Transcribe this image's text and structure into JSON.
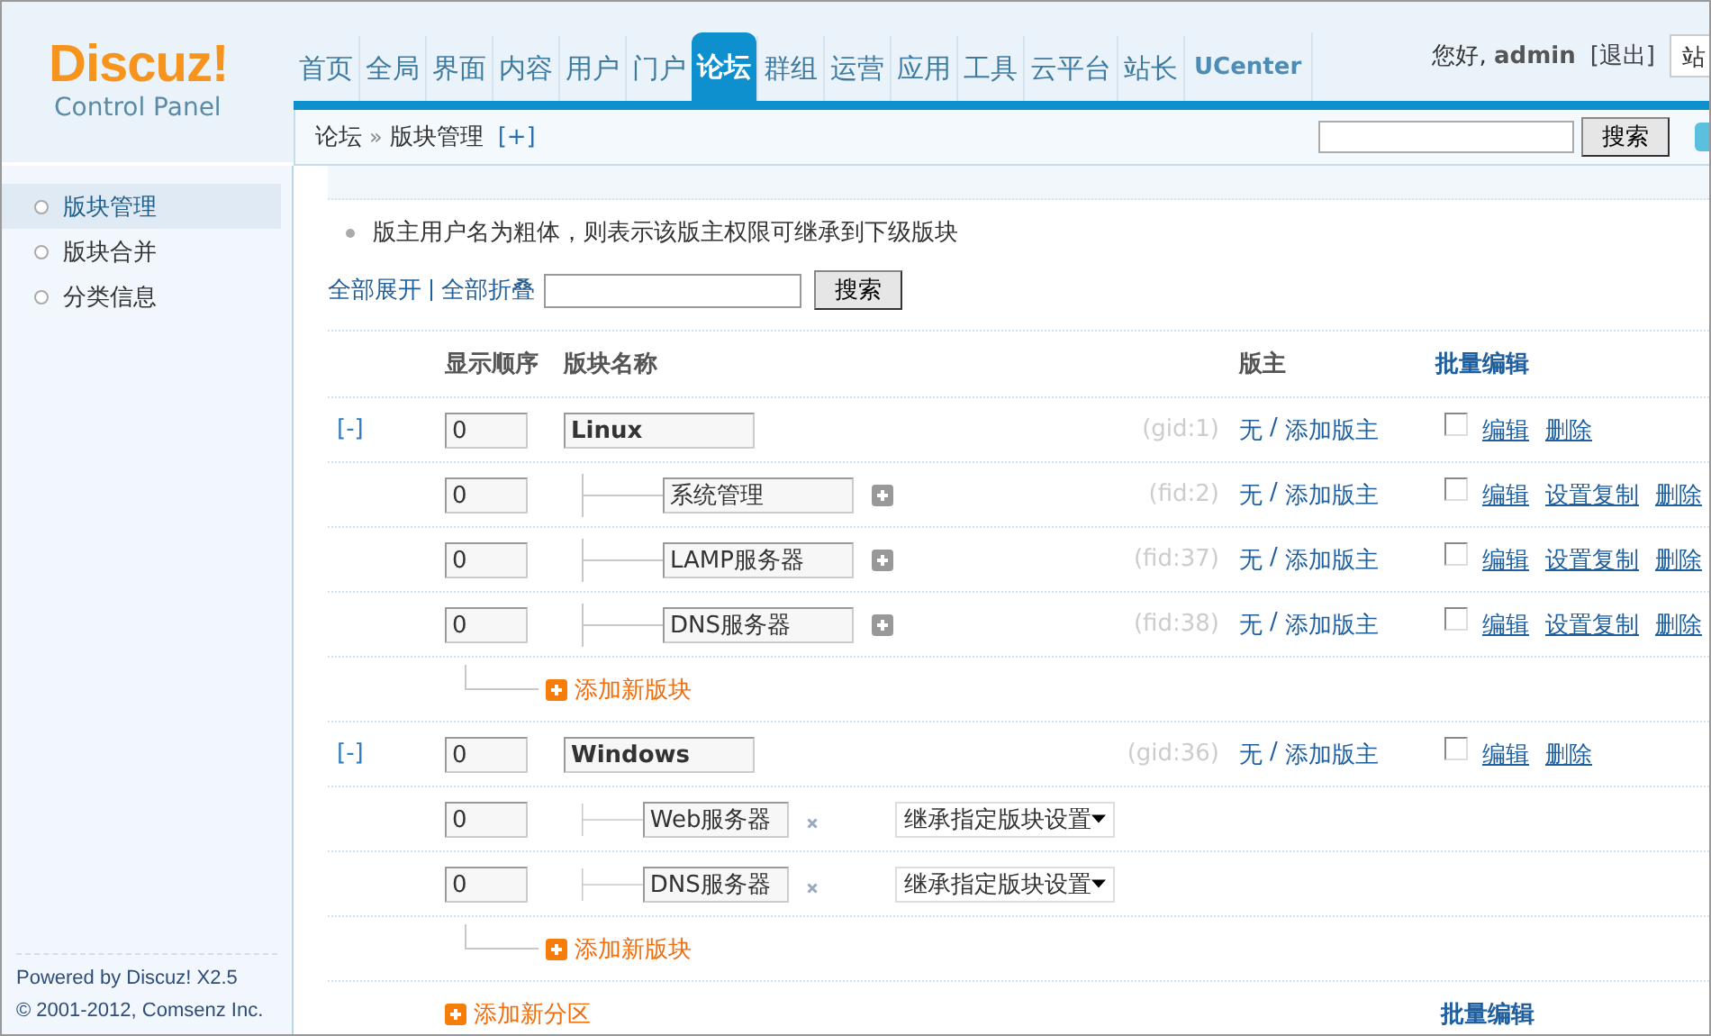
{
  "logo": {
    "name": "Discuz!",
    "subtitle": "Control Panel"
  },
  "nav": [
    {
      "label": "首页",
      "selected": false
    },
    {
      "label": "全局",
      "selected": false
    },
    {
      "label": "界面",
      "selected": false
    },
    {
      "label": "内容",
      "selected": false
    },
    {
      "label": "用户",
      "selected": false
    },
    {
      "label": "门户",
      "selected": false
    },
    {
      "label": "论坛",
      "selected": true
    },
    {
      "label": "群组",
      "selected": false
    },
    {
      "label": "运营",
      "selected": false
    },
    {
      "label": "应用",
      "selected": false
    },
    {
      "label": "工具",
      "selected": false
    },
    {
      "label": "云平台",
      "selected": false
    },
    {
      "label": "站长",
      "selected": false
    },
    {
      "label": "UCenter",
      "selected": false
    }
  ],
  "user": {
    "greeting": "您好,",
    "name": "admin",
    "logout": "[退出]",
    "site_menu": "站"
  },
  "breadcrumb": {
    "items": [
      "论坛",
      "版块管理"
    ],
    "separator": "»",
    "add": "[+]",
    "search_button": "搜索"
  },
  "sidebar": {
    "items": [
      {
        "label": "版块管理",
        "selected": true
      },
      {
        "label": "版块合并",
        "selected": false
      },
      {
        "label": "分类信息",
        "selected": false
      }
    ],
    "footer": [
      "Powered by Discuz! X2.5",
      "© 2001-2012, Comsenz Inc."
    ]
  },
  "tip": "版主用户名为粗体，则表示该版主权限可继承到下级版块",
  "toolbar": {
    "expand_all": "全部展开",
    "collapse_all": "全部折叠",
    "search_button": "搜索"
  },
  "table": {
    "columns": [
      "显示顺序",
      "版块名称",
      "版主",
      "批量编辑"
    ],
    "groups": [
      {
        "toggle": "[-]",
        "order": "0",
        "name": "Linux",
        "id": "(gid:1)",
        "moderator": "无",
        "separator": "/",
        "add_moderator": "添加版主",
        "checked": false,
        "actions": [
          "编辑",
          "删除"
        ],
        "add_forum": "添加新版块",
        "forums": [
          {
            "kind": "expandable",
            "order": "0",
            "name": "系统管理",
            "id": "(fid:2)",
            "moderator": "无",
            "separator": "/",
            "add_moderator": "添加版主",
            "checked": false,
            "actions": [
              "编辑",
              "设置复制",
              "删除"
            ]
          },
          {
            "kind": "expandable",
            "order": "0",
            "name": "LAMP服务器",
            "id": "(fid:37)",
            "moderator": "无",
            "separator": "/",
            "add_moderator": "添加版主",
            "checked": false,
            "actions": [
              "编辑",
              "设置复制",
              "删除"
            ]
          },
          {
            "kind": "expandable",
            "order": "0",
            "name": "DNS服务器",
            "id": "(fid:38)",
            "moderator": "无",
            "separator": "/",
            "add_moderator": "添加版主",
            "checked": false,
            "actions": [
              "编辑",
              "设置复制",
              "删除"
            ]
          }
        ]
      },
      {
        "toggle": "[-]",
        "order": "0",
        "name": "Windows",
        "id": "(gid:36)",
        "moderator": "无",
        "separator": "/",
        "add_moderator": "添加版主",
        "checked": false,
        "actions": [
          "编辑",
          "删除"
        ],
        "add_forum": "添加新版块",
        "forums": [
          {
            "kind": "inherit",
            "order": "0",
            "name": "Web服务器",
            "inherit": "继承指定版块设置"
          },
          {
            "kind": "inherit",
            "order": "0",
            "name": "DNS服务器",
            "inherit": "继承指定版块设置"
          }
        ]
      }
    ]
  },
  "add_category": "添加新分区",
  "footer_batch_edit": "批量编辑"
}
